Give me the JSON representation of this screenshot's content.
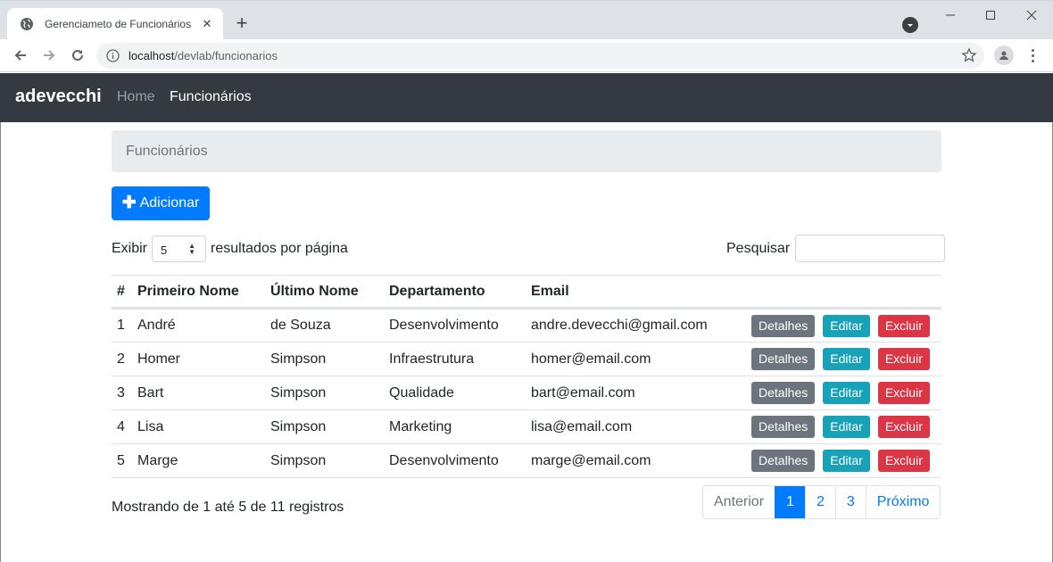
{
  "browser": {
    "tab_title": "Gerenciameto de Funcionários",
    "url_host": "localhost",
    "url_path": "/devlab/funcionarios"
  },
  "navbar": {
    "brand": "adevecchi",
    "links": [
      {
        "label": "Home",
        "active": false
      },
      {
        "label": "Funcionários",
        "active": true
      }
    ]
  },
  "breadcrumb": "Funcionários",
  "add_button": "Adicionar",
  "length_control": {
    "prefix": "Exibir",
    "value": "5",
    "suffix": "resultados por página"
  },
  "search": {
    "label": "Pesquisar",
    "value": ""
  },
  "table": {
    "headers": [
      "#",
      "Primeiro Nome",
      "Último Nome",
      "Departamento",
      "Email"
    ],
    "rows": [
      {
        "id": "1",
        "first": "André",
        "last": "de Souza",
        "dept": "Desenvolvimento",
        "email": "andre.devecchi@gmail.com"
      },
      {
        "id": "2",
        "first": "Homer",
        "last": "Simpson",
        "dept": "Infraestrutura",
        "email": "homer@email.com"
      },
      {
        "id": "3",
        "first": "Bart",
        "last": "Simpson",
        "dept": "Qualidade",
        "email": "bart@email.com"
      },
      {
        "id": "4",
        "first": "Lisa",
        "last": "Simpson",
        "dept": "Marketing",
        "email": "lisa@email.com"
      },
      {
        "id": "5",
        "first": "Marge",
        "last": "Simpson",
        "dept": "Desenvolvimento",
        "email": "marge@email.com"
      }
    ],
    "actions": {
      "details": "Detalhes",
      "edit": "Editar",
      "delete": "Excluir"
    }
  },
  "info": "Mostrando de 1 até 5 de 11 registros",
  "pagination": {
    "previous": "Anterior",
    "pages": [
      "1",
      "2",
      "3"
    ],
    "current": "1",
    "next": "Próximo"
  },
  "colors": {
    "navbar_bg": "#343a40",
    "primary": "#007bff",
    "secondary": "#6c757d",
    "info": "#17a2b8",
    "danger": "#dc3545"
  },
  "icons": [
    "globe-icon",
    "close-icon",
    "plus-icon",
    "tab-search-icon",
    "minimize-icon",
    "maximize-icon",
    "window-close-icon",
    "back-arrow-icon",
    "forward-arrow-icon",
    "reload-icon",
    "info-icon",
    "star-icon",
    "profile-icon",
    "menu-dots-icon"
  ]
}
